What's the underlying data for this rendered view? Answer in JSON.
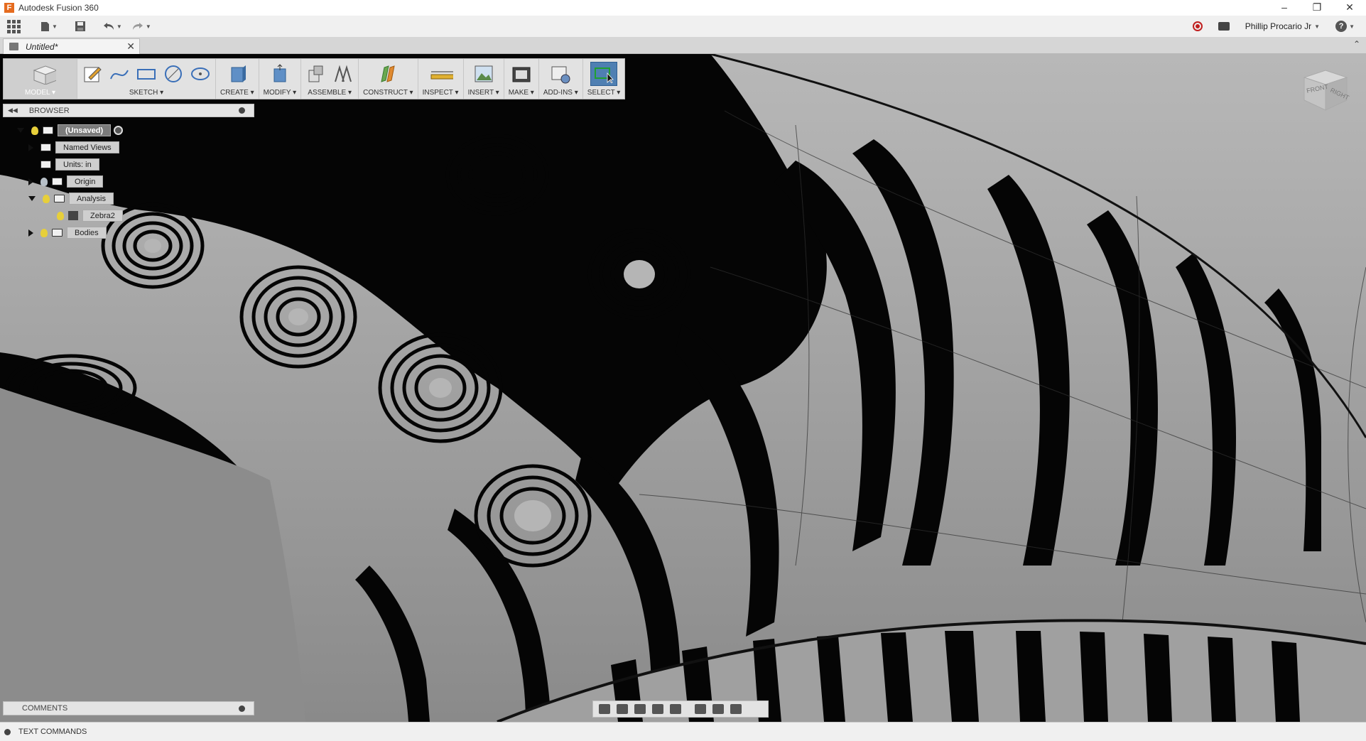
{
  "window": {
    "title": "Autodesk Fusion 360",
    "app_icon_letter": "F",
    "controls": [
      "minimize",
      "restore",
      "close"
    ]
  },
  "quick_access": {
    "user_name": "Phillip Procario Jr",
    "help_label": "?"
  },
  "document_tab": {
    "title": "Untitled*"
  },
  "toolbar": {
    "workspace_label": "MODEL",
    "groups": [
      {
        "label": "SKETCH",
        "icons": [
          "sketch-create-icon",
          "spline-icon",
          "rectangle-icon",
          "circle-icon",
          "ellipse-icon"
        ]
      },
      {
        "label": "CREATE",
        "icons": [
          "box-icon"
        ]
      },
      {
        "label": "MODIFY",
        "icons": [
          "press-pull-icon"
        ]
      },
      {
        "label": "ASSEMBLE",
        "icons": [
          "new-component-icon",
          "joint-icon"
        ]
      },
      {
        "label": "CONSTRUCT",
        "icons": [
          "plane-icon"
        ]
      },
      {
        "label": "INSPECT",
        "icons": [
          "measure-icon"
        ]
      },
      {
        "label": "INSERT",
        "icons": [
          "insert-image-icon"
        ]
      },
      {
        "label": "MAKE",
        "icons": [
          "print-3d-icon"
        ]
      },
      {
        "label": "ADD-INS",
        "icons": [
          "scripts-icon"
        ]
      },
      {
        "label": "SELECT",
        "icons": [
          "select-icon"
        ]
      }
    ]
  },
  "browser": {
    "title": "BROWSER",
    "tree": {
      "root": "(Unsaved)",
      "named_views": "Named Views",
      "units": "Units: in",
      "origin": "Origin",
      "analysis": "Analysis",
      "zebra": "Zebra2",
      "bodies": "Bodies"
    }
  },
  "viewcube": {
    "front": "FRONT",
    "right": "RIGHT"
  },
  "comments": {
    "title": "COMMENTS"
  },
  "text_commands": {
    "label": "TEXT COMMANDS"
  },
  "colors": {
    "select_active": "#4f7fb2",
    "bulb_on": "#e7cf3a",
    "zebra_dark": "#000000",
    "zebra_light": "#a8a8a8"
  }
}
